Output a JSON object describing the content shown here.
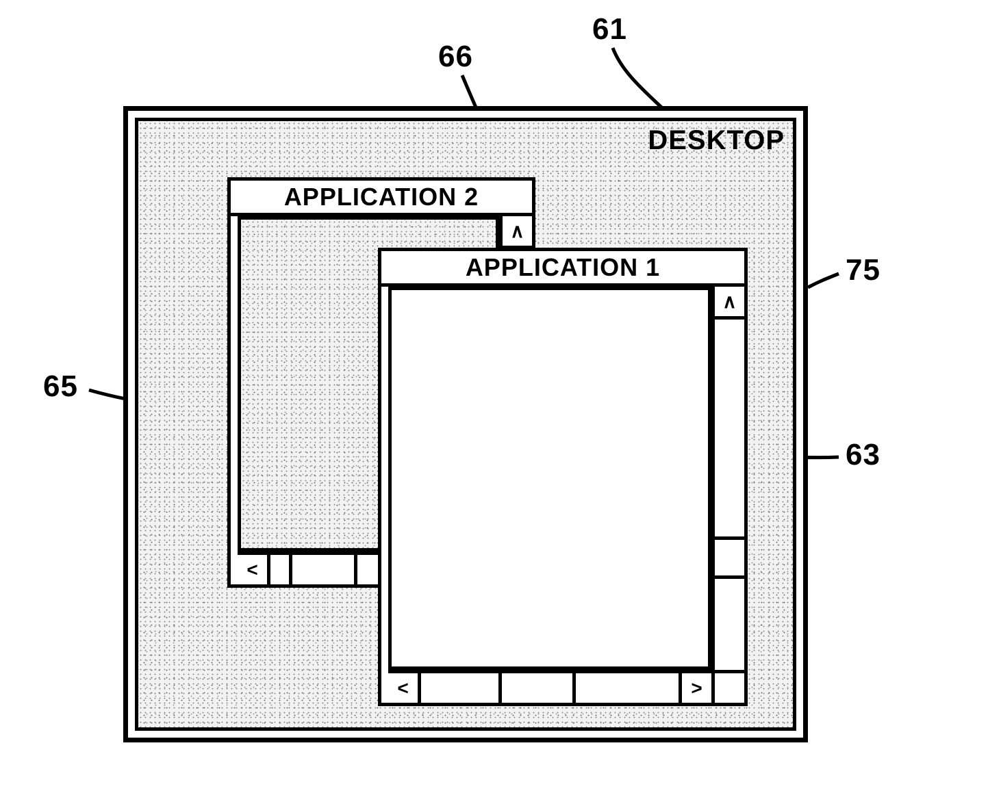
{
  "callouts": {
    "c61": "61",
    "c66": "66",
    "c75": "75",
    "c65": "65",
    "c63": "63"
  },
  "desktop": {
    "label": "DESKTOP"
  },
  "window2": {
    "title": "APPLICATION 2",
    "vscroll": {
      "up_glyph": "∧",
      "thumb_top_pct": 70,
      "thumb_h_pct": 14
    },
    "hscroll": {
      "left_glyph": "<",
      "thumb_left_pct": 8,
      "thumb_w_pct": 30
    }
  },
  "window1": {
    "title": "APPLICATION 1",
    "vscroll": {
      "up_glyph": "∧",
      "thumb_top_pct": 62,
      "thumb_h_pct": 12
    },
    "hscroll": {
      "left_glyph": "<",
      "right_glyph": ">",
      "thumb_left_pct": 30,
      "thumb_w_pct": 30
    }
  }
}
